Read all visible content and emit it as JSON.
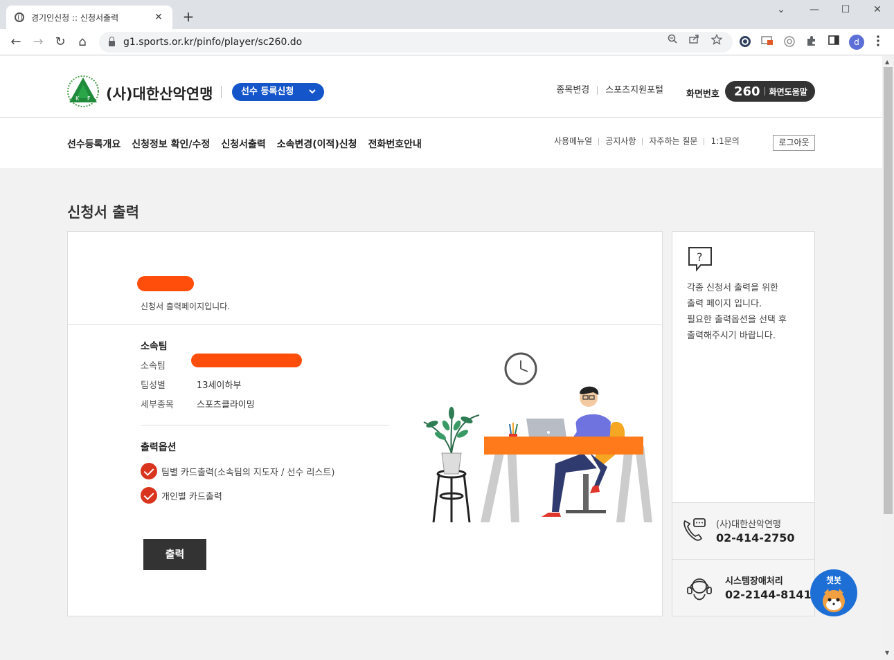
{
  "browser": {
    "tab_title": "경기인신청 :: 신청서출력",
    "tab_close": "✕",
    "new_tab": "+",
    "url": "g1.sports.or.kr/pinfo/player/sc260.do",
    "profile_initial": "d",
    "window_controls": {
      "collapse": "⌄",
      "minimize": "—",
      "maximize": "☐",
      "close": "✕"
    },
    "nav": {
      "back": "←",
      "forward": "→",
      "reload": "↻",
      "home": "⌂"
    }
  },
  "header": {
    "org_name": "(사)대한산악연맹",
    "app_select_label": "선수 등록신청",
    "top_links": [
      "종목변경",
      "스포츠지원포털"
    ],
    "screen_no_label": "화면번호",
    "screen_no": "260",
    "screen_help": "화면도움말",
    "gnb": [
      "선수등록개요",
      "신청정보 확인/수정",
      "신청서출력",
      "소속변경(이적)신청",
      "전화번호안내"
    ],
    "util_links": [
      "사용메뉴얼",
      "공지사항",
      "자주하는 질문",
      "1:1문의"
    ],
    "logout": "로그아웃"
  },
  "main": {
    "page_title": "신청서 출력",
    "intro_text": "신청서 출력페이지입니다.",
    "team_section_title": "소속팀",
    "team_rows": [
      {
        "label": "소속팀",
        "value": ""
      },
      {
        "label": "팀성별",
        "value": "13세이하부"
      },
      {
        "label": "세부종목",
        "value": "스포츠클라이밍"
      }
    ],
    "options_title": "출력옵션",
    "options": [
      "팀별 카드출력(소속팀의 지도자 / 선수 리스트)",
      "개인별 카드출력"
    ],
    "print_button": "출력"
  },
  "side": {
    "help_lines": [
      "각종 신청서 출력을 위한",
      "출력 페이지 입니다.",
      "필요한 출력옵션을 선택 후",
      "출력해주시기 바랍니다."
    ],
    "contact1_name": "(사)대한산악연맹",
    "contact1_phone": "02-414-2750",
    "contact2_name": "시스템장애처리",
    "contact2_phone": "02-2144-8141",
    "chatbot_label": "챗봇"
  },
  "colors": {
    "accent_blue": "#1455c9",
    "check_red": "#d9341e",
    "redaction_orange": "#ff4d0c",
    "dark_button": "#333333"
  }
}
